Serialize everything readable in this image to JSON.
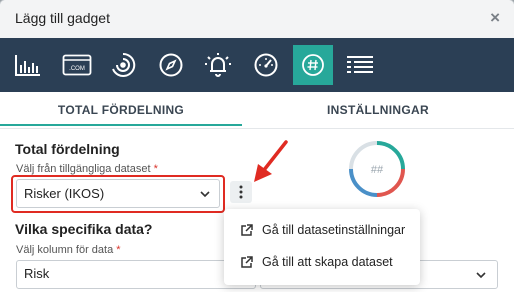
{
  "dialog": {
    "title": "Lägg till gadget",
    "close_label": "×"
  },
  "iconbar": {
    "items": [
      {
        "name": "bar-chart-icon"
      },
      {
        "name": "dotcom-icon",
        "label": ".COM"
      },
      {
        "name": "radial-chart-icon"
      },
      {
        "name": "compass-icon"
      },
      {
        "name": "alarm-bell-icon"
      },
      {
        "name": "gauge-icon"
      },
      {
        "name": "hash-circle-icon",
        "active": true
      },
      {
        "name": "list-lines-icon"
      }
    ],
    "colors": {
      "background": "#2b3f55",
      "active": "#27a89a"
    }
  },
  "tabs": [
    {
      "label": "TOTAL FÖRDELNING",
      "active": true
    },
    {
      "label": "INSTÄLLNINGAR",
      "active": false
    }
  ],
  "main": {
    "section1_title": "Total fördelning",
    "dataset_label": "Välj från tillgängliga dataset",
    "required_mark": "*",
    "dataset_value": "Risker (IKOS)",
    "section2_title": "Vilka specifika data?",
    "column_label": "Välj kolumn för data",
    "column_value": "Risk"
  },
  "preview": {
    "symbol": "##",
    "colors": [
      "#27a89a",
      "#e0564f",
      "#4a90c8",
      "#d9e0e5"
    ]
  },
  "context_menu": {
    "items": [
      {
        "label": "Gå till datasetinställningar",
        "icon": "external-link-icon"
      },
      {
        "label": "Gå till att skapa dataset",
        "icon": "external-link-icon"
      }
    ]
  },
  "annotation": {
    "color": "#e02b22"
  }
}
